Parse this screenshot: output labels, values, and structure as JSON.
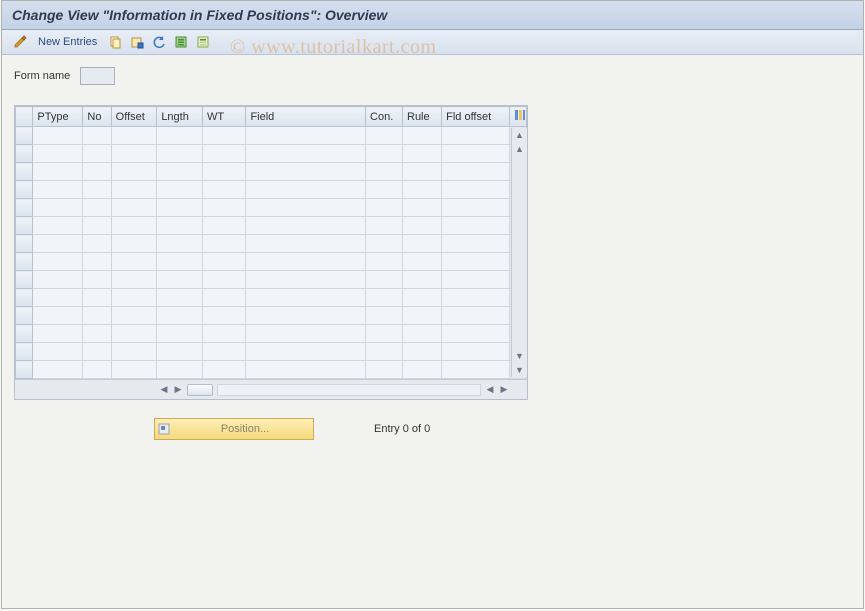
{
  "window": {
    "title": "Change View \"Information in Fixed Positions\": Overview"
  },
  "toolbar": {
    "new_entries_label": "New Entries"
  },
  "form": {
    "name_label": "Form name",
    "name_value": ""
  },
  "table": {
    "columns": [
      "PType",
      "No",
      "Offset",
      "Lngth",
      "WT",
      "Field",
      "Con.",
      "Rule",
      "Fld offset"
    ],
    "row_count": 14
  },
  "footer": {
    "position_button": "Position...",
    "entry_text": "Entry 0 of 0"
  },
  "watermark": {
    "text": "© www.tutorialkart.com"
  }
}
